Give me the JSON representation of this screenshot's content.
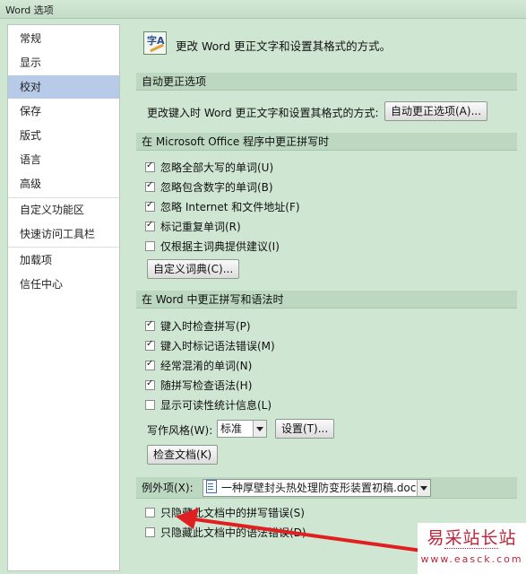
{
  "window": {
    "title": "Word 选项"
  },
  "sidebar": {
    "items": [
      {
        "label": "常规"
      },
      {
        "label": "显示"
      },
      {
        "label": "校对",
        "selected": true
      },
      {
        "label": "保存"
      },
      {
        "label": "版式"
      },
      {
        "label": "语言"
      },
      {
        "label": "高级"
      },
      {
        "label": "自定义功能区"
      },
      {
        "label": "快速访问工具栏"
      },
      {
        "label": "加载项"
      },
      {
        "label": "信任中心"
      }
    ]
  },
  "main": {
    "intro_icon": "abc-proofing-icon",
    "intro_text": "更改 Word 更正文字和设置其格式的方式。",
    "autocorrect": {
      "header": "自动更正选项",
      "prompt": "更改键入时 Word 更正文字和设置其格式的方式:",
      "button": "自动更正选项(A)..."
    },
    "office_spelling": {
      "header": "在 Microsoft Office 程序中更正拼写时",
      "options": [
        {
          "label": "忽略全部大写的单词(U)",
          "checked": true
        },
        {
          "label": "忽略包含数字的单词(B)",
          "checked": true
        },
        {
          "label": "忽略 Internet 和文件地址(F)",
          "checked": true
        },
        {
          "label": "标记重复单词(R)",
          "checked": true
        },
        {
          "label": "仅根据主词典提供建议(I)",
          "checked": false
        }
      ],
      "custom_dict_button": "自定义词典(C)..."
    },
    "word_spelling": {
      "header": "在 Word 中更正拼写和语法时",
      "options": [
        {
          "label": "键入时检查拼写(P)",
          "checked": true
        },
        {
          "label": "键入时标记语法错误(M)",
          "checked": true
        },
        {
          "label": "经常混淆的单词(N)",
          "checked": true
        },
        {
          "label": "随拼写检查语法(H)",
          "checked": true
        },
        {
          "label": "显示可读性统计信息(L)",
          "checked": false
        }
      ],
      "writing_style_label": "写作风格(W):",
      "writing_style_value": "标准",
      "settings_button": "设置(T)...",
      "check_doc_button": "检查文档(K)"
    },
    "exceptions": {
      "label": "例外项(X):",
      "document": "一种厚壁封头热处理防变形装置初稿.doc",
      "options": [
        {
          "label": "只隐藏此文档中的拼写错误(S)",
          "checked": false
        },
        {
          "label": "只隐藏此文档中的语法错误(D)",
          "checked": false
        }
      ]
    }
  },
  "annotation": {
    "arrow_color": "#e02020"
  },
  "watermark": {
    "text": "易采站长站",
    "url": "www.easck.com"
  }
}
